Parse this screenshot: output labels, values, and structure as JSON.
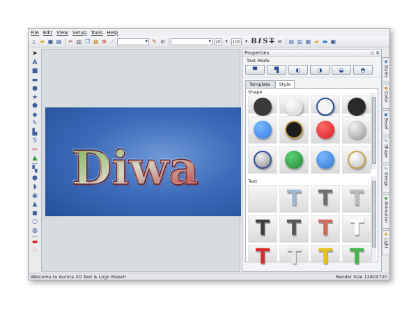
{
  "menu": [
    "File",
    "Edit",
    "View",
    "Setup",
    "Tools",
    "Help"
  ],
  "toolbar": {
    "font_size": "20",
    "zoom": "100",
    "bold": "B",
    "italic": "I",
    "shadow": "S",
    "strike": "T"
  },
  "logo_text": "Diwa",
  "properties": {
    "title": "Properties",
    "text_mode_label": "Text Mode",
    "tabs": [
      "Template",
      "Style"
    ],
    "active_tab": "Style",
    "shape_label": "Shape",
    "text_label": "Text"
  },
  "shape_colors": {
    "row1": [
      "#3a3a3a",
      "#e8e8e8",
      "#f4f4f4",
      "#2a2a2a"
    ],
    "row2": [
      "#2f7fe0",
      "#1c1c1c",
      "#d81e1e",
      "#c8c8c8"
    ],
    "row3": [
      "#d8d8d8",
      "#1e8a36",
      "#2e79cf",
      "#d9d9d9"
    ]
  },
  "text_colors": {
    "row1": [
      "",
      "#9fb8d6",
      "#6e6e6e",
      "#bdbdbd"
    ],
    "row2": [
      "#3d3d3d",
      "#565656",
      "#d06a5a",
      "#ffffff"
    ],
    "row3": [
      "#d62b2b",
      "#e8e8e8",
      "#e8c21a",
      "#43b54a"
    ]
  },
  "side_tabs": [
    "Styles",
    "Color",
    "Bevel",
    "Shape",
    "Design",
    "Animation",
    "Light"
  ],
  "status": {
    "message": "Welcome to Aurora 3D Text & Logo Maker!",
    "render_size": "Render Size 1280X720"
  },
  "accent": "#3f6fb0"
}
